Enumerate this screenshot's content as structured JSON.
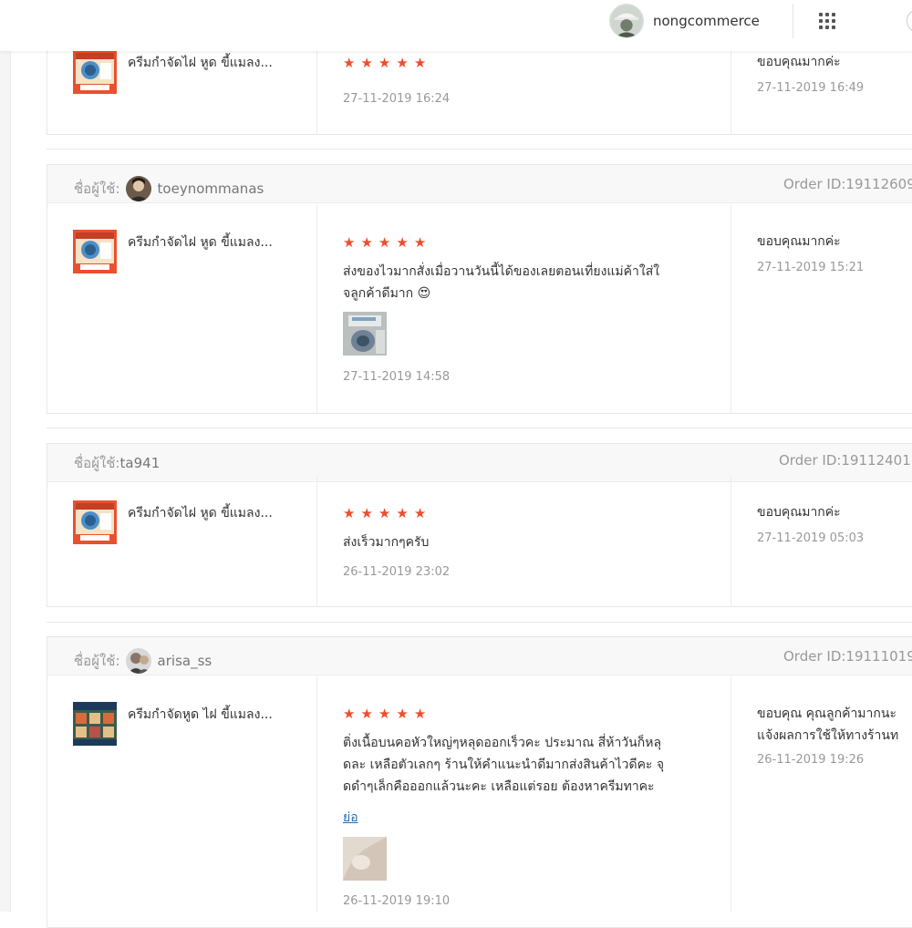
{
  "topbar": {
    "shop_name": "nongcommerce"
  },
  "labels": {
    "username_prefix": "ชื่อผู้ใช้:",
    "collapse": "ย่อ"
  },
  "colors": {
    "star": "#ee4d2d",
    "link": "#1f6fb3"
  },
  "reviews": [
    {
      "product_name": "ครีมกำจัดไฝ หูด ขี้แมลง...",
      "rating": 5,
      "review_date": "27-11-2019 16:24",
      "reply": "ขอบคุณมากค่ะ",
      "reply_date": "27-11-2019 16:49"
    },
    {
      "username": "toeynommanas",
      "order_id": "Order ID:19112609",
      "product_name": "ครีมกำจัดไฝ หูด ขี้แมลง...",
      "rating": 5,
      "comment_line1": "ส่งของไวมากสั่งเมื่อวานวันนี้ได้ของเลยตอนเที่ยงแม่ค้าใส่ใ",
      "comment_line2": "จลูกค้าดีมาก 😍",
      "review_date": "27-11-2019 14:58",
      "reply": "ขอบคุณมากค่ะ",
      "reply_date": "27-11-2019 15:21"
    },
    {
      "username": "ta941",
      "order_id": "Order ID:19112401",
      "product_name": "ครีมกำจัดไฝ หูด ขี้แมลง...",
      "rating": 5,
      "comment_line1": "ส่งเร็วมากๆครับ",
      "review_date": "26-11-2019 23:02",
      "reply": "ขอบคุณมากค่ะ",
      "reply_date": "27-11-2019 05:03"
    },
    {
      "username": "arisa_ss",
      "order_id": "Order ID:19111019",
      "product_name": "ครีมกำจัดหูด ไฝ ขี้แมลง...",
      "rating": 5,
      "comment_line1": "ติ่งเนื้อบนคอหัวใหญ่ๆหลุดออกเร็วคะ ประมาณ สี่ห้าวันก็หลุ",
      "comment_line2": "ดละ เหลือตัวเลกๆ ร้านให้คำแนะนำดีมากส่งสินค้าไวดีคะ จุ",
      "comment_line3": "ดดำๆเล็กคือออกแล้วนะคะ เหลือแต่รอย ต้องหาครีมทาคะ",
      "review_date": "26-11-2019 19:10",
      "reply_line1": "ขอบคุณ คุณลูกค้ามากนะ",
      "reply_line2": "แจ้งผลการใช้ให้ทางร้านท",
      "reply_date": "26-11-2019 19:26"
    }
  ]
}
